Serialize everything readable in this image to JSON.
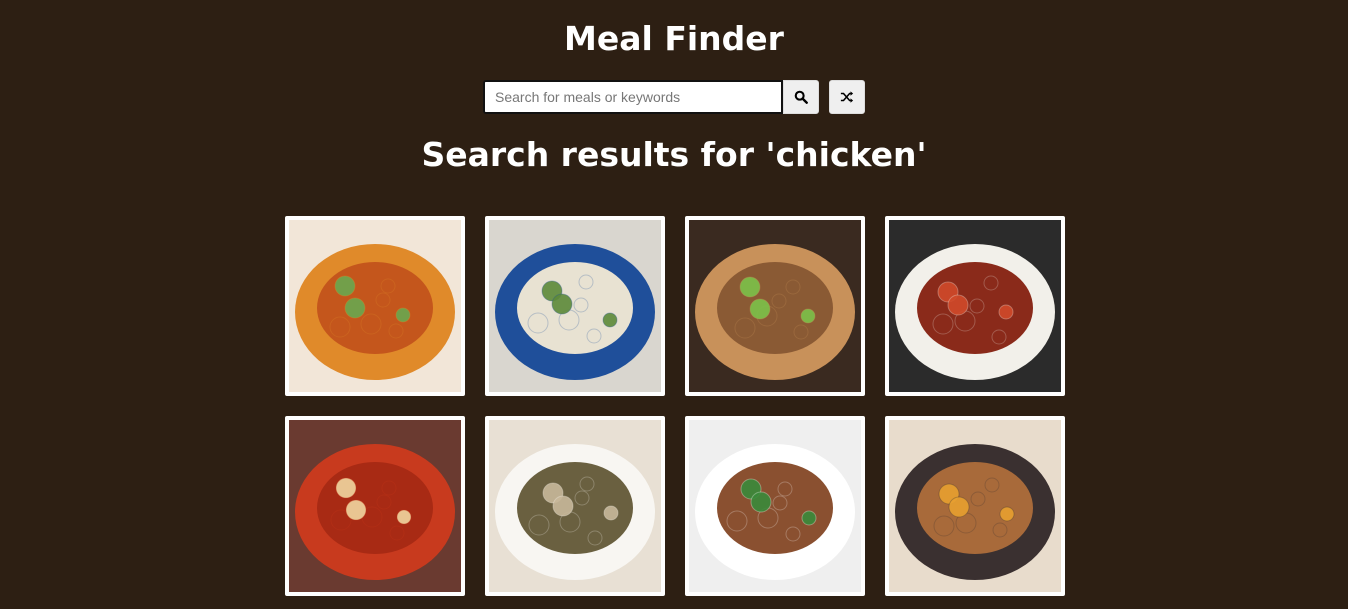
{
  "header": {
    "title": "Meal Finder"
  },
  "search": {
    "placeholder": "Search for meals or keywords",
    "value": "",
    "search_icon": "search-icon",
    "random_icon": "shuffle-icon"
  },
  "results": {
    "heading": "Search results for 'chicken'"
  },
  "colors": {
    "background": "#2d1f13",
    "text": "#ffffff",
    "card_border": "#ffffff",
    "button_bg": "#efefef"
  },
  "meals": [
    {
      "name": "meal-1",
      "palette": [
        "#f2e6d8",
        "#e08a2a",
        "#c4561c",
        "#6aa84f"
      ]
    },
    {
      "name": "meal-2",
      "palette": [
        "#d9d6cf",
        "#1f4f9a",
        "#e8e2d2",
        "#5d8a3a"
      ]
    },
    {
      "name": "meal-3",
      "palette": [
        "#3a2a20",
        "#c8915a",
        "#8a5a34",
        "#7cc24a"
      ]
    },
    {
      "name": "meal-4",
      "palette": [
        "#2b2b2b",
        "#f2f0ea",
        "#8a2a1a",
        "#d04a2a"
      ]
    },
    {
      "name": "meal-5",
      "palette": [
        "#6a3a30",
        "#c83a1e",
        "#a82a14",
        "#f1d6a0"
      ]
    },
    {
      "name": "meal-6",
      "palette": [
        "#e8e0d4",
        "#f8f6f2",
        "#6a6040",
        "#c8b89a"
      ]
    },
    {
      "name": "meal-7",
      "palette": [
        "#efefef",
        "#ffffff",
        "#8a5030",
        "#3a8a3a"
      ]
    },
    {
      "name": "meal-8",
      "palette": [
        "#e8dccc",
        "#3a3030",
        "#a86a3a",
        "#e8a030"
      ]
    }
  ]
}
